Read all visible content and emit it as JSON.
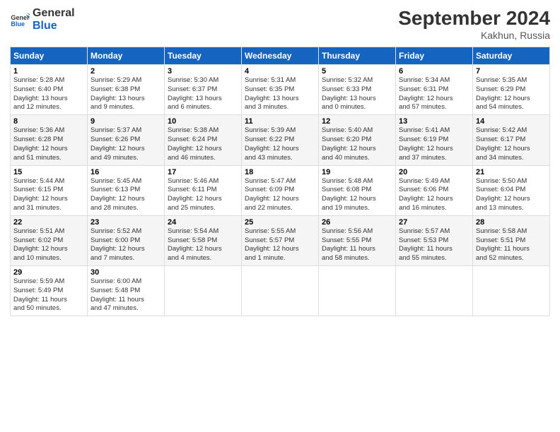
{
  "logo": {
    "text_general": "General",
    "text_blue": "Blue"
  },
  "header": {
    "month": "September 2024",
    "location": "Kakhun, Russia"
  },
  "days_of_week": [
    "Sunday",
    "Monday",
    "Tuesday",
    "Wednesday",
    "Thursday",
    "Friday",
    "Saturday"
  ],
  "weeks": [
    [
      {
        "day": "1",
        "sunrise": "5:28 AM",
        "sunset": "6:40 PM",
        "daylight": "13 hours and 12 minutes."
      },
      {
        "day": "2",
        "sunrise": "5:29 AM",
        "sunset": "6:38 PM",
        "daylight": "13 hours and 9 minutes."
      },
      {
        "day": "3",
        "sunrise": "5:30 AM",
        "sunset": "6:37 PM",
        "daylight": "13 hours and 6 minutes."
      },
      {
        "day": "4",
        "sunrise": "5:31 AM",
        "sunset": "6:35 PM",
        "daylight": "13 hours and 3 minutes."
      },
      {
        "day": "5",
        "sunrise": "5:32 AM",
        "sunset": "6:33 PM",
        "daylight": "13 hours and 0 minutes."
      },
      {
        "day": "6",
        "sunrise": "5:34 AM",
        "sunset": "6:31 PM",
        "daylight": "12 hours and 57 minutes."
      },
      {
        "day": "7",
        "sunrise": "5:35 AM",
        "sunset": "6:29 PM",
        "daylight": "12 hours and 54 minutes."
      }
    ],
    [
      {
        "day": "8",
        "sunrise": "5:36 AM",
        "sunset": "6:28 PM",
        "daylight": "12 hours and 51 minutes."
      },
      {
        "day": "9",
        "sunrise": "5:37 AM",
        "sunset": "6:26 PM",
        "daylight": "12 hours and 49 minutes."
      },
      {
        "day": "10",
        "sunrise": "5:38 AM",
        "sunset": "6:24 PM",
        "daylight": "12 hours and 46 minutes."
      },
      {
        "day": "11",
        "sunrise": "5:39 AM",
        "sunset": "6:22 PM",
        "daylight": "12 hours and 43 minutes."
      },
      {
        "day": "12",
        "sunrise": "5:40 AM",
        "sunset": "6:20 PM",
        "daylight": "12 hours and 40 minutes."
      },
      {
        "day": "13",
        "sunrise": "5:41 AM",
        "sunset": "6:19 PM",
        "daylight": "12 hours and 37 minutes."
      },
      {
        "day": "14",
        "sunrise": "5:42 AM",
        "sunset": "6:17 PM",
        "daylight": "12 hours and 34 minutes."
      }
    ],
    [
      {
        "day": "15",
        "sunrise": "5:44 AM",
        "sunset": "6:15 PM",
        "daylight": "12 hours and 31 minutes."
      },
      {
        "day": "16",
        "sunrise": "5:45 AM",
        "sunset": "6:13 PM",
        "daylight": "12 hours and 28 minutes."
      },
      {
        "day": "17",
        "sunrise": "5:46 AM",
        "sunset": "6:11 PM",
        "daylight": "12 hours and 25 minutes."
      },
      {
        "day": "18",
        "sunrise": "5:47 AM",
        "sunset": "6:09 PM",
        "daylight": "12 hours and 22 minutes."
      },
      {
        "day": "19",
        "sunrise": "5:48 AM",
        "sunset": "6:08 PM",
        "daylight": "12 hours and 19 minutes."
      },
      {
        "day": "20",
        "sunrise": "5:49 AM",
        "sunset": "6:06 PM",
        "daylight": "12 hours and 16 minutes."
      },
      {
        "day": "21",
        "sunrise": "5:50 AM",
        "sunset": "6:04 PM",
        "daylight": "12 hours and 13 minutes."
      }
    ],
    [
      {
        "day": "22",
        "sunrise": "5:51 AM",
        "sunset": "6:02 PM",
        "daylight": "12 hours and 10 minutes."
      },
      {
        "day": "23",
        "sunrise": "5:52 AM",
        "sunset": "6:00 PM",
        "daylight": "12 hours and 7 minutes."
      },
      {
        "day": "24",
        "sunrise": "5:54 AM",
        "sunset": "5:58 PM",
        "daylight": "12 hours and 4 minutes."
      },
      {
        "day": "25",
        "sunrise": "5:55 AM",
        "sunset": "5:57 PM",
        "daylight": "12 hours and 1 minute."
      },
      {
        "day": "26",
        "sunrise": "5:56 AM",
        "sunset": "5:55 PM",
        "daylight": "11 hours and 58 minutes."
      },
      {
        "day": "27",
        "sunrise": "5:57 AM",
        "sunset": "5:53 PM",
        "daylight": "11 hours and 55 minutes."
      },
      {
        "day": "28",
        "sunrise": "5:58 AM",
        "sunset": "5:51 PM",
        "daylight": "11 hours and 52 minutes."
      }
    ],
    [
      {
        "day": "29",
        "sunrise": "5:59 AM",
        "sunset": "5:49 PM",
        "daylight": "11 hours and 50 minutes."
      },
      {
        "day": "30",
        "sunrise": "6:00 AM",
        "sunset": "5:48 PM",
        "daylight": "11 hours and 47 minutes."
      },
      null,
      null,
      null,
      null,
      null
    ]
  ]
}
